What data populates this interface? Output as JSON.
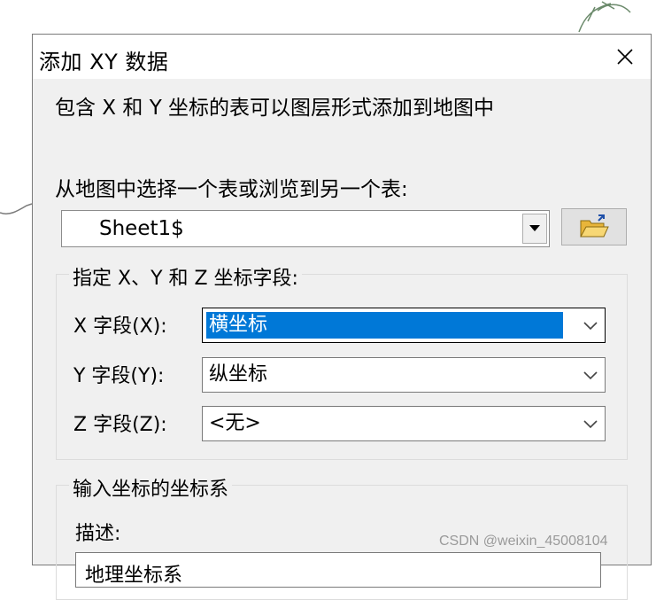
{
  "dialog": {
    "title": "添加 XY 数据",
    "description": "包含 X 和 Y 坐标的表可以图层形式添加到地图中",
    "choose_label": "从地图中选择一个表或浏览到另一个表:",
    "table_select": {
      "value": "Sheet1$"
    },
    "fields_group": {
      "legend": "指定 X、Y 和 Z 坐标字段:",
      "x": {
        "label": "X 字段(X):",
        "value": "横坐标"
      },
      "y": {
        "label": "Y 字段(Y):",
        "value": "纵坐标"
      },
      "z": {
        "label": "Z 字段(Z):",
        "value": "<无>"
      }
    },
    "coord_group": {
      "legend": "输入坐标的坐标系",
      "desc_label": "描述:",
      "desc_value": "地理坐标系"
    }
  },
  "watermark": "CSDN @weixin_45008104",
  "icons": [
    "close-icon",
    "dropdown-arrow-icon",
    "open-folder-icon",
    "chevron-down-icon"
  ],
  "colors": {
    "selection": "#0078d7",
    "dialog_bg": "#f0f0f0"
  }
}
